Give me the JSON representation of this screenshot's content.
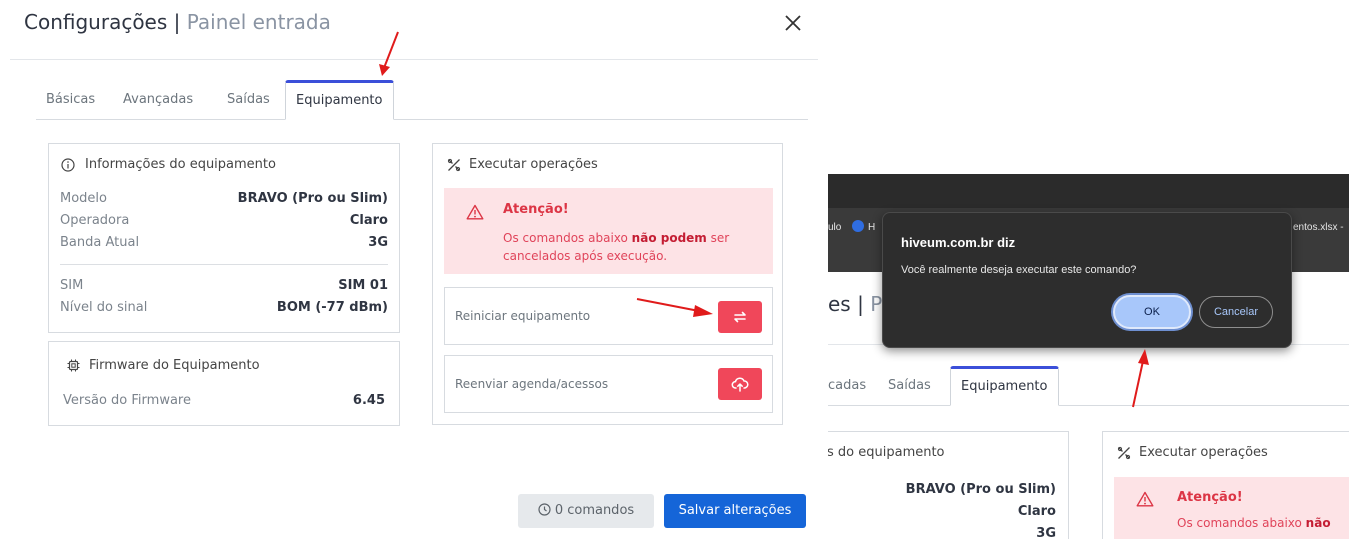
{
  "modal": {
    "title": "Configurações |",
    "subtitle": "Painel entrada",
    "close_icon": "close-icon"
  },
  "tabs": [
    {
      "label": "Básicas"
    },
    {
      "label": "Avançadas"
    },
    {
      "label": "Saídas"
    },
    {
      "label": "Equipamento",
      "active": true
    }
  ],
  "equipment_info": {
    "title": "Informações do equipamento",
    "icon": "info-icon",
    "rows": [
      {
        "label": "Modelo",
        "value": "BRAVO (Pro ou Slim)"
      },
      {
        "label": "Operadora",
        "value": "Claro"
      },
      {
        "label": "Banda Atual",
        "value": "3G"
      },
      {
        "label": "SIM",
        "value": "SIM 01"
      },
      {
        "label": "Nível do sinal",
        "value": "BOM (-77 dBm)"
      }
    ]
  },
  "firmware": {
    "title": "Firmware do Equipamento",
    "icon": "chip-icon",
    "label": "Versão do Firmware",
    "value": "6.45"
  },
  "operations": {
    "title": "Executar operações",
    "icon": "tools-icon",
    "alert_title": "Atenção!",
    "alert_text_1": "Os comandos abaixo ",
    "alert_text_bold": "não podem",
    "alert_text_2": " ser cancelados após execução.",
    "items": [
      {
        "label": "Reiniciar equipamento",
        "icon": "swap-icon"
      },
      {
        "label": "Reenviar agenda/acessos",
        "icon": "cloud-upload-icon"
      }
    ]
  },
  "footer": {
    "commands_label": "0 comandos",
    "save_label": "Salvar alterações"
  },
  "browser_bookmarks": {
    "left_text": "ulo",
    "h_text": "H",
    "right_text": "entos.xlsx -"
  },
  "second_view": {
    "title": "es |",
    "subtitle": "Pa",
    "tabs": [
      "cadas",
      "Saídas",
      "Equipamento"
    ],
    "info_title": "s do equipamento",
    "model": "BRAVO (Pro ou Slim)",
    "carrier": "Claro",
    "band": "3G",
    "ops_title": "Executar operações",
    "alert_title": "Atenção!",
    "alert_text": "Os comandos abaixo ",
    "alert_bold": "não"
  },
  "dialog": {
    "title": "hiveum.com.br diz",
    "message": "Você realmente deseja executar este comando?",
    "ok_label": "OK",
    "cancel_label": "Cancelar"
  },
  "colors": {
    "accent": "#3b4fd9",
    "danger": "#f0475a",
    "primary": "#1565d8",
    "annotation": "#e01b1b"
  }
}
